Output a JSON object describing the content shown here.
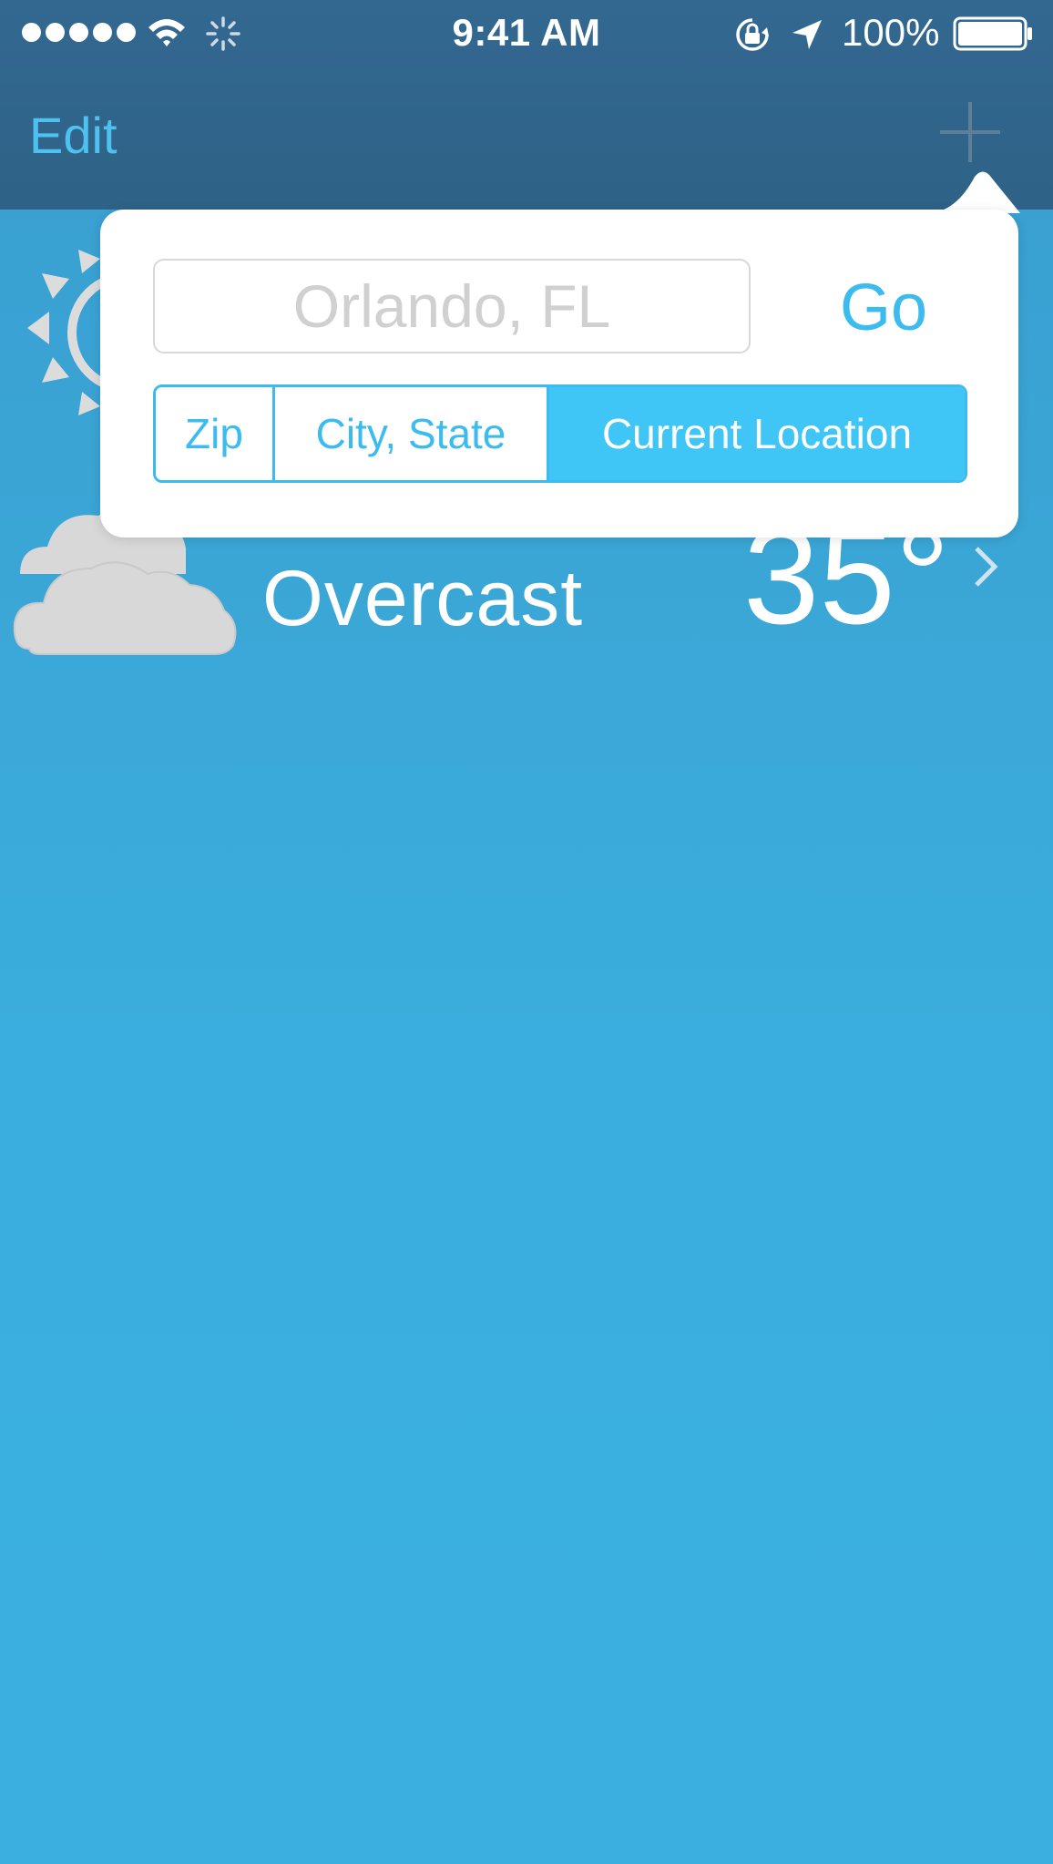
{
  "status_bar": {
    "time": "9:41 AM",
    "battery_percent": "100%",
    "signal_dots": 5,
    "icons": [
      "wifi-icon",
      "activity-icon",
      "lock-rotation-icon",
      "location-arrow-icon",
      "battery-icon"
    ]
  },
  "nav": {
    "edit_label": "Edit",
    "add_icon": "plus-icon"
  },
  "popover": {
    "search_placeholder": "Orlando, FL",
    "search_value": "",
    "go_label": "Go",
    "segments": [
      {
        "label": "Zip",
        "selected": false
      },
      {
        "label": "City, State",
        "selected": false
      },
      {
        "label": "Current Location",
        "selected": true
      }
    ]
  },
  "weather": {
    "rows": [
      {
        "icon": "sun-icon"
      },
      {
        "icon": "cloud-icon",
        "condition": "Overcast",
        "temperature": "35°"
      }
    ]
  },
  "colors": {
    "nav_bar": "#2e6286",
    "background": "#3bb0e0",
    "accent": "#3bbbee",
    "segment_selected": "#3fc5f6"
  }
}
